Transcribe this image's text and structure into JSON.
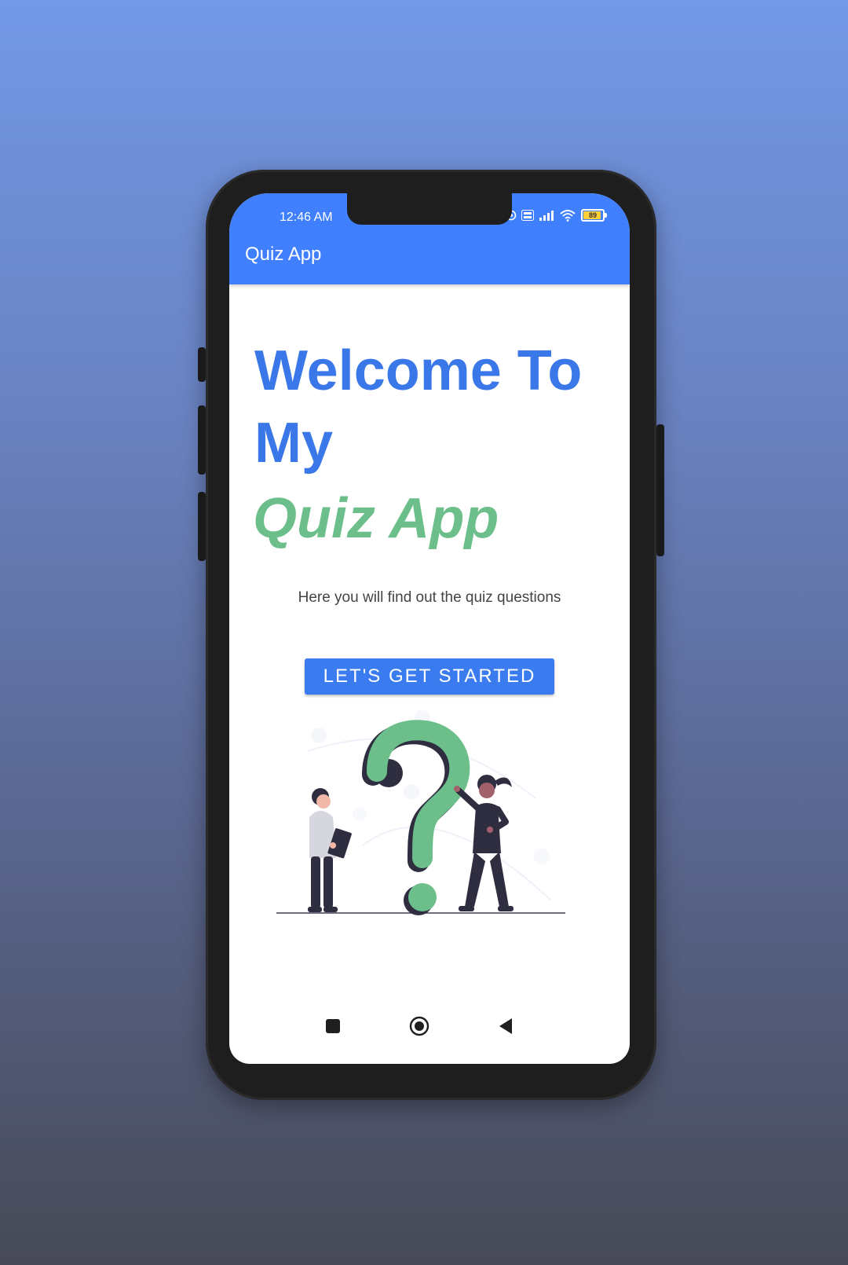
{
  "status_bar": {
    "time": "12:46 AM",
    "battery_level": "89"
  },
  "app_bar": {
    "title": "Quiz App"
  },
  "welcome": {
    "heading": "Welcome To My",
    "heading_accent": "Quiz App",
    "subtitle": "Here you will find out the quiz questions",
    "cta_label": "LET'S GET STARTED"
  },
  "colors": {
    "primary": "#4080ff",
    "heading": "#3a77e8",
    "accent": "#6cbf8a"
  },
  "navigation": {
    "buttons": [
      "recents-icon",
      "home-icon",
      "back-icon"
    ]
  }
}
